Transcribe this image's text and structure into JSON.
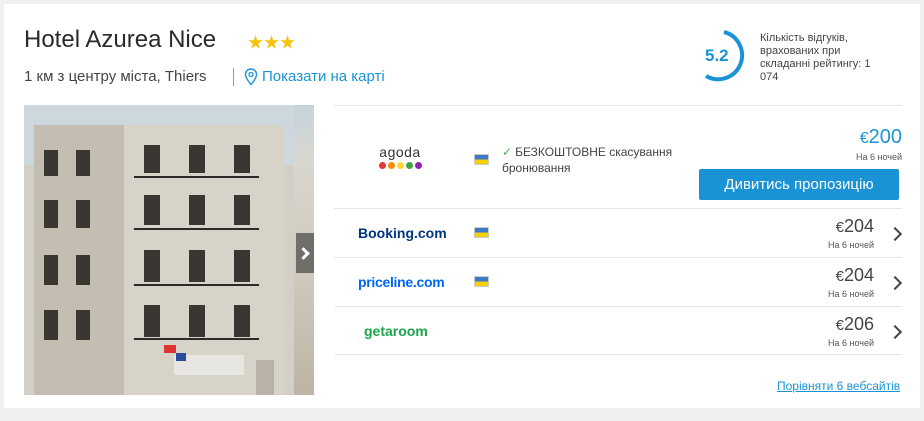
{
  "hotel": {
    "name": "Hotel Azurea Nice",
    "stars": 3,
    "location": "1 км з центру міста, Thiers",
    "map_link": "Показати на карті",
    "photo_alt": "Hotel Azurea Nice facade"
  },
  "rating": {
    "value": "5.2",
    "text": "Кількість відгуків, врахованих при складанні рейтингу: 1 074"
  },
  "offers": [
    {
      "provider": "agoda",
      "free_cancel": "БЕЗКОШТОВНЕ скасування бронювання",
      "currency": "€",
      "price": "200",
      "nights": "На 6 ночей",
      "button": "Дивитись пропозицію"
    },
    {
      "provider": "Booking.com",
      "currency": "€",
      "price": "204",
      "nights": "На 6 ночей"
    },
    {
      "provider": "priceline.com",
      "currency": "€",
      "price": "204",
      "nights": "На 6 ночей"
    },
    {
      "provider": "getaroom",
      "currency": "€",
      "price": "206",
      "nights": "На 6 ночей"
    }
  ],
  "compare_link": "Порівняти 6 вебсайтів",
  "colors": {
    "accent": "#1a93d6",
    "star": "#f9c20a",
    "booking_blue": "#003580",
    "priceline_blue": "#0068ef",
    "getaroom_green": "#18a54a"
  }
}
